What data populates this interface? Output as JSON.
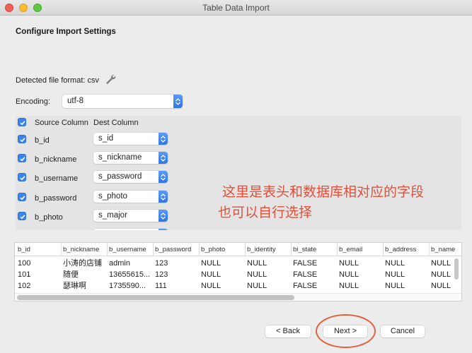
{
  "window": {
    "title": "Table Data Import"
  },
  "heading": "Configure Import Settings",
  "detected_format": {
    "label": "Detected file format: csv",
    "icon": "wrench-icon"
  },
  "encoding": {
    "label": "Encoding:",
    "value": "utf-8"
  },
  "mapping": {
    "header": {
      "source_label": "Source Column",
      "dest_label": "Dest Column",
      "checked": true
    },
    "rows": [
      {
        "source": "b_id",
        "dest": "s_id",
        "checked": true
      },
      {
        "source": "b_nickname",
        "dest": "s_nickname",
        "checked": true
      },
      {
        "source": "b_username",
        "dest": "s_password",
        "checked": true
      },
      {
        "source": "b_password",
        "dest": "s_photo",
        "checked": true
      },
      {
        "source": "b_photo",
        "dest": "s_major",
        "checked": true
      }
    ]
  },
  "annotation": {
    "line1": "这里是表头和数据库相对应的字段",
    "line2": "也可以自行选择",
    "color": "#e0503a"
  },
  "preview": {
    "columns": [
      "b_id",
      "b_nickname",
      "b_username",
      "b_password",
      "b_photo",
      "b_identity",
      "bi_state",
      "b_email",
      "b_address",
      "b_name"
    ],
    "rows": [
      [
        "100",
        "小涛的店铺",
        "admin",
        "123",
        "NULL",
        "NULL",
        "FALSE",
        "NULL",
        "NULL",
        "NULL"
      ],
      [
        "101",
        "随便",
        "13655615...",
        "123",
        "NULL",
        "NULL",
        "FALSE",
        "NULL",
        "NULL",
        "NULL"
      ],
      [
        "102",
        "瑟琳啊",
        "1735590...",
        "111",
        "NULL",
        "NULL",
        "FALSE",
        "NULL",
        "NULL",
        "NULL"
      ]
    ]
  },
  "buttons": {
    "back": "< Back",
    "next": "Next >",
    "cancel": "Cancel"
  }
}
